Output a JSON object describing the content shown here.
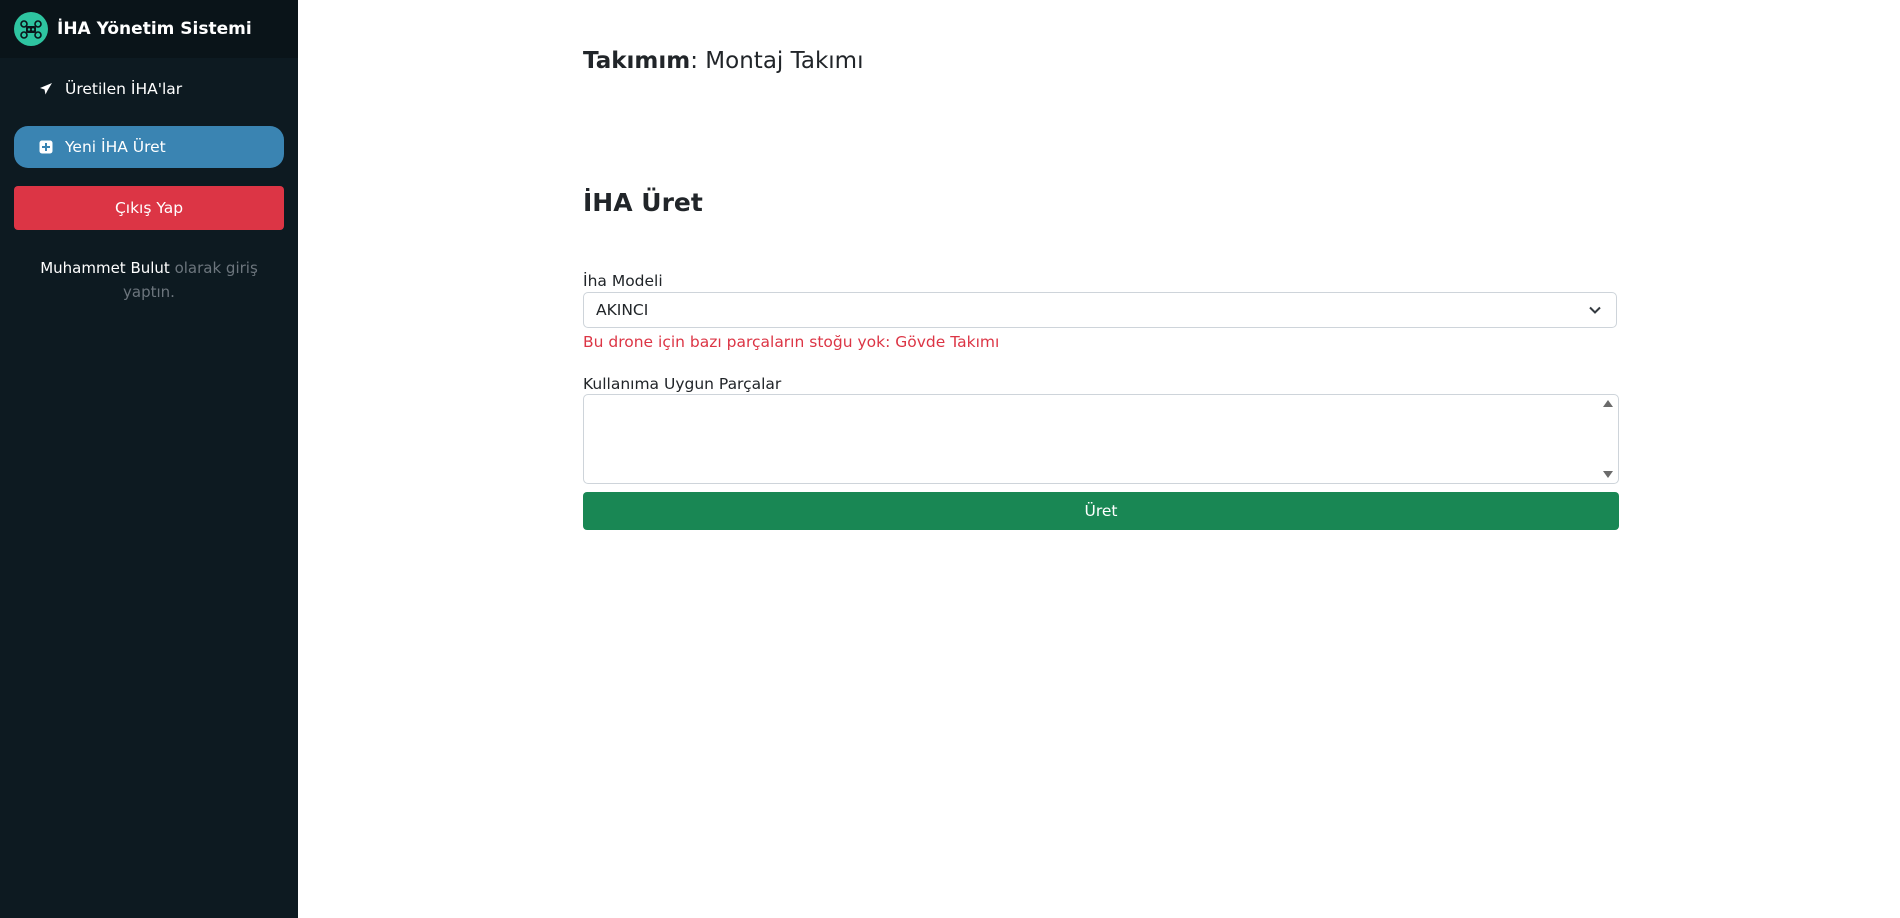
{
  "app": {
    "title": "İHA Yönetim Sistemi",
    "logo_icon": "drone-icon"
  },
  "sidebar": {
    "items": [
      {
        "label": "Üretilen İHA'lar",
        "icon": "plane-icon",
        "active": false
      },
      {
        "label": "Yeni İHA Üret",
        "icon": "plus-square-icon",
        "active": true
      }
    ],
    "logout_label": "Çıkış Yap",
    "user": {
      "name": "Muhammet Bulut",
      "suffix": " olarak giriş yaptın."
    }
  },
  "main": {
    "team_label": "Takımım",
    "team_value": ": Montaj Takımı",
    "section_title": "İHA Üret",
    "model_label": "İha Modeli",
    "model_selected": "AKINCI",
    "error_message": "Bu drone için bazı parçaların stoğu yok: Gövde Takımı",
    "parts_label": "Kullanıma Uygun Parçalar",
    "parts_options": [],
    "submit_label": "Üret"
  },
  "colors": {
    "sidebar_bg": "#0d1a21",
    "active_item": "#3a84b2",
    "danger": "#dc3545",
    "success": "#198754",
    "brand_accent": "#2ec4a0"
  }
}
